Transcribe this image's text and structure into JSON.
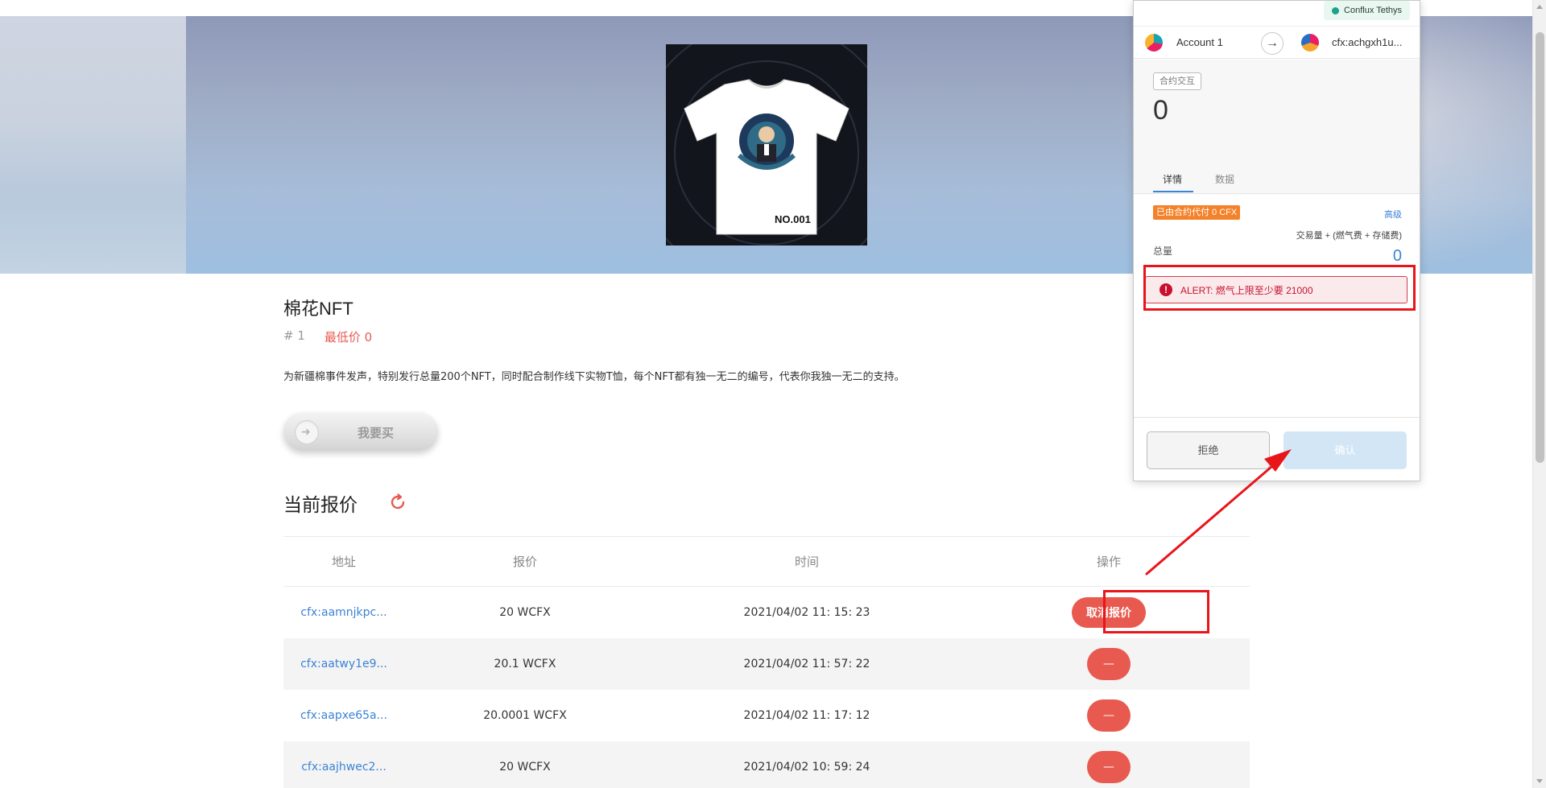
{
  "product": {
    "title": "棉花NFT",
    "id": "# 1",
    "min_price": "最低价 0",
    "description": "为新疆棉事件发声，特别发行总量200个NFT，同时配合制作线下实物T恤，每个NFT都有独一无二的编号，代表你我独一无二的支持。",
    "buy_label": "我要买",
    "art_number": "NO.001"
  },
  "offers": {
    "title": "当前报价",
    "columns": [
      "地址",
      "报价",
      "时间",
      "操作"
    ],
    "rows": [
      {
        "address": "cfx:aamnjkpc...",
        "price": "20 WCFX",
        "time": "2021/04/02 11: 15: 23",
        "action": "取消报价"
      },
      {
        "address": "cfx:aatwy1e9...",
        "price": "20.1 WCFX",
        "time": "2021/04/02 11: 57: 22",
        "action": "—"
      },
      {
        "address": "cfx:aapxe65a...",
        "price": "20.0001 WCFX",
        "time": "2021/04/02 11: 17: 12",
        "action": "—"
      },
      {
        "address": "cfx:aajhwec2...",
        "price": "20 WCFX",
        "time": "2021/04/02 10: 59: 24",
        "action": "—"
      }
    ]
  },
  "wallet": {
    "network": "Conflux Tethys",
    "from_account": "Account 1",
    "to_address": "cfx:achgxh1u...",
    "method": "合约交互",
    "value": "0",
    "tabs": [
      "详情",
      "数据"
    ],
    "sponsor_badge": "已由合约代付 0 CFX",
    "advanced": "高级",
    "fee_breakdown": "交易量 + (燃气费 + 存储费)",
    "total_label": "总量",
    "total_value": "0",
    "alert": "ALERT: 燃气上限至少要 21000",
    "reject": "拒绝",
    "confirm": "确认"
  },
  "colors": {
    "accent_red": "#e85a4f",
    "link_blue": "#3b83d6",
    "annotation_red": "#e8151b",
    "sponsor_orange": "#f4822a"
  }
}
